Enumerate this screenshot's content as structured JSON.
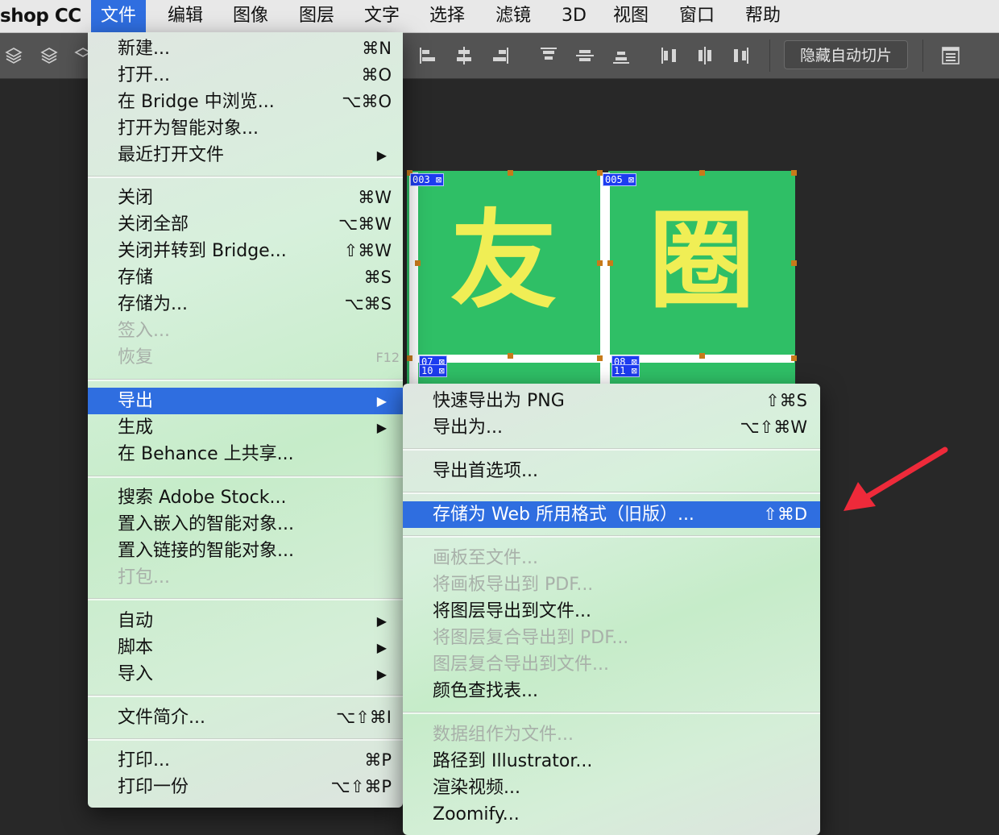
{
  "menubar": {
    "app_name": "shop CC",
    "items": [
      "文件",
      "编辑",
      "图像",
      "图层",
      "文字",
      "选择",
      "滤镜",
      "3D",
      "视图",
      "窗口",
      "帮助"
    ]
  },
  "toolbar": {
    "hide_slices_label": "隐藏自动切片"
  },
  "canvas": {
    "slices": [
      {
        "char": "友",
        "tag_top": "003",
        "tag_bottom_a": "07",
        "tag_bottom_b": "10"
      },
      {
        "char": "圈",
        "tag_top": "005",
        "tag_bottom_a": "08",
        "tag_bottom_b": "11"
      }
    ],
    "colors": {
      "slice_bg": "#2fbf66",
      "slice_text": "#f0ee55",
      "slice_tag": "#1d3cf0"
    }
  },
  "file_menu": {
    "items": [
      {
        "label": "新建...",
        "shortcut": "⌘N"
      },
      {
        "label": "打开...",
        "shortcut": "⌘O"
      },
      {
        "label": "在 Bridge 中浏览...",
        "shortcut": "⌥⌘O"
      },
      {
        "label": "打开为智能对象...",
        "shortcut": ""
      },
      {
        "label": "最近打开文件",
        "shortcut": "▶"
      },
      {
        "label": "关闭",
        "shortcut": "⌘W"
      },
      {
        "label": "关闭全部",
        "shortcut": "⌥⌘W"
      },
      {
        "label": "关闭并转到 Bridge...",
        "shortcut": "⇧⌘W"
      },
      {
        "label": "存储",
        "shortcut": "⌘S"
      },
      {
        "label": "存储为...",
        "shortcut": "⌥⌘S"
      },
      {
        "label": "签入...",
        "shortcut": ""
      },
      {
        "label": "恢复",
        "shortcut": "F12"
      },
      {
        "label": "导出",
        "shortcut": "▶"
      },
      {
        "label": "生成",
        "shortcut": "▶"
      },
      {
        "label": "在 Behance 上共享...",
        "shortcut": ""
      },
      {
        "label": "搜索 Adobe Stock...",
        "shortcut": ""
      },
      {
        "label": "置入嵌入的智能对象...",
        "shortcut": ""
      },
      {
        "label": "置入链接的智能对象...",
        "shortcut": ""
      },
      {
        "label": "打包...",
        "shortcut": ""
      },
      {
        "label": "自动",
        "shortcut": "▶"
      },
      {
        "label": "脚本",
        "shortcut": "▶"
      },
      {
        "label": "导入",
        "shortcut": "▶"
      },
      {
        "label": "文件简介...",
        "shortcut": "⌥⇧⌘I"
      },
      {
        "label": "打印...",
        "shortcut": "⌘P"
      },
      {
        "label": "打印一份",
        "shortcut": "⌥⇧⌘P"
      }
    ]
  },
  "export_menu": {
    "items": [
      {
        "label": "快速导出为 PNG",
        "shortcut": "⇧⌘S"
      },
      {
        "label": "导出为...",
        "shortcut": "⌥⇧⌘W"
      },
      {
        "label": "导出首选项...",
        "shortcut": ""
      },
      {
        "label": "存储为 Web 所用格式（旧版）...",
        "shortcut": "⇧⌘D"
      },
      {
        "label": "画板至文件...",
        "shortcut": ""
      },
      {
        "label": "将画板导出到 PDF...",
        "shortcut": ""
      },
      {
        "label": "将图层导出到文件...",
        "shortcut": ""
      },
      {
        "label": "将图层复合导出到 PDF...",
        "shortcut": ""
      },
      {
        "label": "图层复合导出到文件...",
        "shortcut": ""
      },
      {
        "label": "颜色查找表...",
        "shortcut": ""
      },
      {
        "label": "数据组作为文件...",
        "shortcut": ""
      },
      {
        "label": "路径到 Illustrator...",
        "shortcut": ""
      },
      {
        "label": "渲染视频...",
        "shortcut": ""
      },
      {
        "label": "Zoomify...",
        "shortcut": ""
      }
    ]
  },
  "colors": {
    "highlight": "#2f6ee0",
    "annotation_arrow": "#ee2a3a"
  }
}
